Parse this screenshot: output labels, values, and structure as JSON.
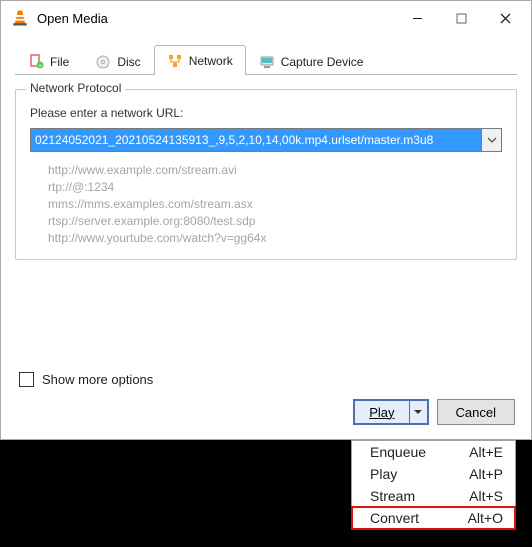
{
  "window": {
    "title": "Open Media"
  },
  "tabs": {
    "file": "File",
    "disc": "Disc",
    "network": "Network",
    "capture": "Capture Device"
  },
  "group": {
    "title": "Network Protocol",
    "prompt": "Please enter a network URL:",
    "url_value": "02124052021_20210524135913_,9,5,2,10,14,00k.mp4.urlset/master.m3u8",
    "hints": [
      "http://www.example.com/stream.avi",
      "rtp://@:1234",
      "mms://mms.examples.com/stream.asx",
      "rtsp://server.example.org:8080/test.sdp",
      "http://www.yourtube.com/watch?v=gg64x"
    ]
  },
  "footer": {
    "show_more": "Show more options",
    "play": "Play",
    "cancel": "Cancel"
  },
  "menu": {
    "items": [
      {
        "label": "Enqueue",
        "shortcut": "Alt+E"
      },
      {
        "label": "Play",
        "shortcut": "Alt+P"
      },
      {
        "label": "Stream",
        "shortcut": "Alt+S"
      },
      {
        "label": "Convert",
        "shortcut": "Alt+O"
      }
    ]
  }
}
